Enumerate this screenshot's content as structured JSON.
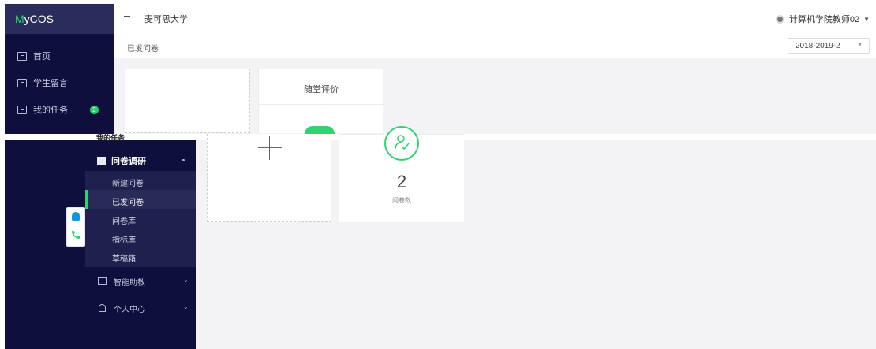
{
  "app": {
    "logo_prefix": "M",
    "logo_rest": "yCOS"
  },
  "sidebar": {
    "items": [
      {
        "label": "首页",
        "icon": "layout-icon"
      },
      {
        "label": "学生留言",
        "icon": "message-icon"
      },
      {
        "label": "我的任务",
        "icon": "task-icon",
        "badge": "2"
      }
    ]
  },
  "header": {
    "school": "麦可思大学",
    "user": "计算机学院教师02"
  },
  "subheader": {
    "title": "已发问卷",
    "semester": "2018-2019-2"
  },
  "cards": {
    "eval_title": "随堂评价",
    "count_value": "2",
    "count_label": "问卷数"
  },
  "sidebar2": {
    "group_label": "问卷调研",
    "sub_items": [
      "新建问卷",
      "已发问卷",
      "问卷库",
      "指标库",
      "草稿箱"
    ],
    "active_index": 1,
    "nav": [
      {
        "label": "智能助教",
        "icon": "monitor-icon"
      },
      {
        "label": "个人中心",
        "icon": "person-icon"
      }
    ]
  },
  "colors": {
    "sidebar": "#0f0f3e",
    "accent": "#2bd670",
    "background": "#f3f3f5"
  }
}
